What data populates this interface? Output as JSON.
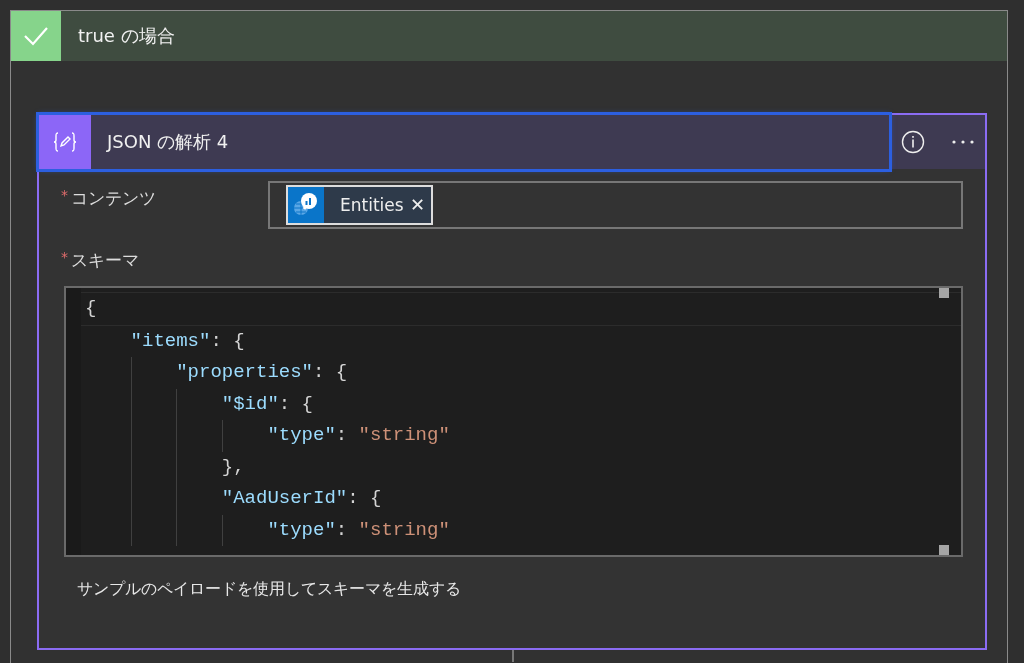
{
  "scope": {
    "title": "true の場合"
  },
  "action": {
    "title": "JSON の解析 4",
    "focused": true,
    "fields": [
      {
        "label": "コンテンツ",
        "required_mark": "*",
        "kind": "tokens",
        "tokens": [
          {
            "label": "Entities",
            "remove": "✕"
          }
        ]
      },
      {
        "label": "スキーマ",
        "required_mark": "*",
        "kind": "code",
        "lines": [
          {
            "tokens": [
              {
                "kind": "punct",
                "text": "{"
              }
            ],
            "children": [
              {
                "tokens": [
                  {
                    "kind": "key",
                    "text": "\"items\""
                  },
                  {
                    "kind": "punct",
                    "text": ": {"
                  }
                ],
                "children": [
                  {
                    "tokens": [
                      {
                        "kind": "key",
                        "text": "\"properties\""
                      },
                      {
                        "kind": "punct",
                        "text": ": {"
                      }
                    ],
                    "children": [
                      {
                        "tokens": [
                          {
                            "kind": "key",
                            "text": "\"$id\""
                          },
                          {
                            "kind": "punct",
                            "text": ": {"
                          }
                        ],
                        "children": [
                          {
                            "tokens": [
                              {
                                "kind": "key",
                                "text": "\"type\""
                              },
                              {
                                "kind": "punct",
                                "text": ": "
                              },
                              {
                                "kind": "string",
                                "text": "\"string\""
                              }
                            ]
                          }
                        ]
                      },
                      {
                        "tokens": [
                          {
                            "kind": "punct",
                            "text": "},"
                          }
                        ]
                      },
                      {
                        "tokens": [
                          {
                            "kind": "key",
                            "text": "\"AadUserId\""
                          },
                          {
                            "kind": "punct",
                            "text": ": {"
                          }
                        ],
                        "children": [
                          {
                            "tokens": [
                              {
                                "kind": "key",
                                "text": "\"type\""
                              },
                              {
                                "kind": "punct",
                                "text": ": "
                              },
                              {
                                "kind": "string",
                                "text": "\"string\""
                              }
                            ]
                          }
                        ]
                      }
                    ]
                  }
                ]
              }
            ]
          }
        ]
      }
    ],
    "link": "サンプルのペイロードを使用してスキーマを生成する"
  }
}
